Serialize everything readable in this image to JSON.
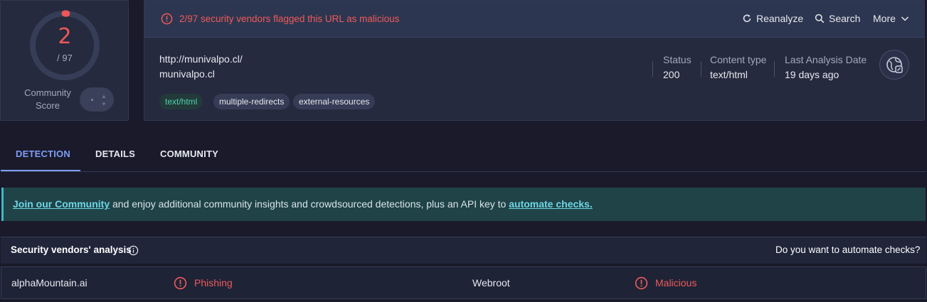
{
  "colors": {
    "accent": "#7f9cf5",
    "malicious": "#ee5a5a",
    "background": "#1a1a2a",
    "card": "#252a3e",
    "banner": "#1f4347",
    "tag_green": "#4fd1b0"
  },
  "score": {
    "value": "2",
    "total": "/ 97",
    "community_label": "Community Score",
    "detected_fraction": 0.0206
  },
  "header": {
    "alert_icon": "alert-circle-icon",
    "alert_text": "2/97 security vendors flagged this URL as malicious",
    "actions": {
      "reanalyze": "Reanalyze",
      "search": "Search",
      "more": "More"
    }
  },
  "resource": {
    "url": "http://munivalpo.cl/",
    "host": "munivalpo.cl",
    "tags": [
      "text/html",
      "multiple-redirects",
      "external-resources"
    ],
    "meta": {
      "status_label": "Status",
      "status_value": "200",
      "content_type_label": "Content type",
      "content_type_value": "text/html",
      "last_analysis_label": "Last Analysis Date",
      "last_analysis_value": "19 days ago"
    }
  },
  "tabs": [
    "DETECTION",
    "DETAILS",
    "COMMUNITY"
  ],
  "active_tab": "DETECTION",
  "banner": {
    "link1": "Join our Community",
    "middle": " and enjoy additional community insights and crowdsourced detections, plus an API key to ",
    "link2": "automate checks."
  },
  "vendors": {
    "title": "Security vendors' analysis",
    "automate_prompt": "Do you want to automate checks?",
    "rows": [
      [
        {
          "name": "alphaMountain.ai",
          "verdict": "Phishing"
        },
        {
          "name": "Webroot",
          "verdict": "Malicious"
        }
      ]
    ]
  }
}
